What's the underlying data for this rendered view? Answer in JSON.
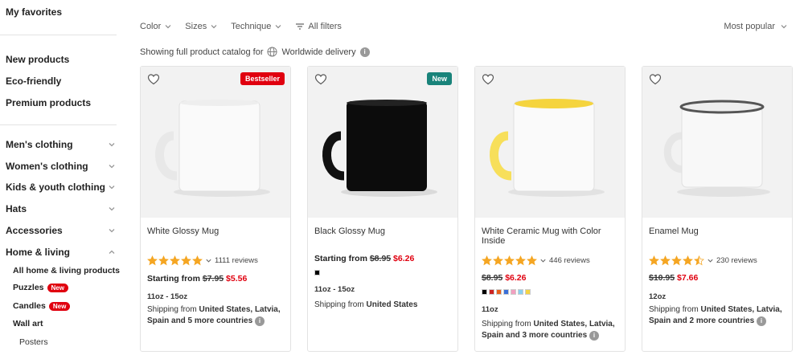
{
  "sidebar": {
    "favorites": "My favorites",
    "links": [
      "New products",
      "Eco-friendly",
      "Premium products"
    ],
    "categories": [
      {
        "label": "Men's clothing",
        "expanded": false
      },
      {
        "label": "Women's clothing",
        "expanded": false
      },
      {
        "label": "Kids & youth clothing",
        "expanded": false
      },
      {
        "label": "Hats",
        "expanded": false
      },
      {
        "label": "Accessories",
        "expanded": false
      },
      {
        "label": "Home & living",
        "expanded": true
      }
    ],
    "subitems": {
      "all": "All home & living products",
      "puzzles": "Puzzles",
      "puzzles_badge": "New",
      "candles": "Candles",
      "candles_badge": "New",
      "wall_art": "Wall art",
      "posters": "Posters"
    }
  },
  "filters": {
    "color": "Color",
    "sizes": "Sizes",
    "technique": "Technique",
    "all_filters": "All filters",
    "sort": "Most popular"
  },
  "catalog_note": {
    "prefix": "Showing full product catalog for",
    "region": "Worldwide delivery"
  },
  "colors": {
    "accent_red": "#e0000f",
    "badge_new": "#19837a",
    "star": "#f5a623"
  },
  "products": [
    {
      "title": "White Glossy Mug",
      "badge": "Bestseller",
      "stars": 5,
      "reviews": "1111 reviews",
      "price_prefix": "Starting from",
      "old_price": "$7.95",
      "new_price": "$5.56",
      "sizes": "11oz - 15oz",
      "ship_prefix": "Shipping from",
      "ship_countries": "United States, Latvia, Spain and 5 more countries"
    },
    {
      "title": "Black Glossy Mug",
      "badge": "New",
      "price_prefix": "Starting from",
      "old_price": "$8.95",
      "new_price": "$6.26",
      "swatches": [
        "#000000"
      ],
      "sizes": "11oz - 15oz",
      "ship_prefix": "Shipping from",
      "ship_countries": "United States"
    },
    {
      "title": "White Ceramic Mug with Color Inside",
      "stars": 5,
      "reviews": "446 reviews",
      "old_price": "$8.95",
      "new_price": "$6.26",
      "swatches": [
        "#000000",
        "#cc2222",
        "#e8601c",
        "#3a6fd8",
        "#f2a0c0",
        "#8ad0f0",
        "#f5d442"
      ],
      "sizes": "11oz",
      "ship_prefix": "Shipping from",
      "ship_countries": "United States, Latvia, Spain and 3 more countries"
    },
    {
      "title": "Enamel Mug",
      "stars": 4.5,
      "reviews": "230 reviews",
      "old_price": "$10.95",
      "new_price": "$7.66",
      "sizes": "12oz",
      "ship_prefix": "Shipping from",
      "ship_countries": "United States, Latvia, Spain and 2 more countries"
    }
  ]
}
